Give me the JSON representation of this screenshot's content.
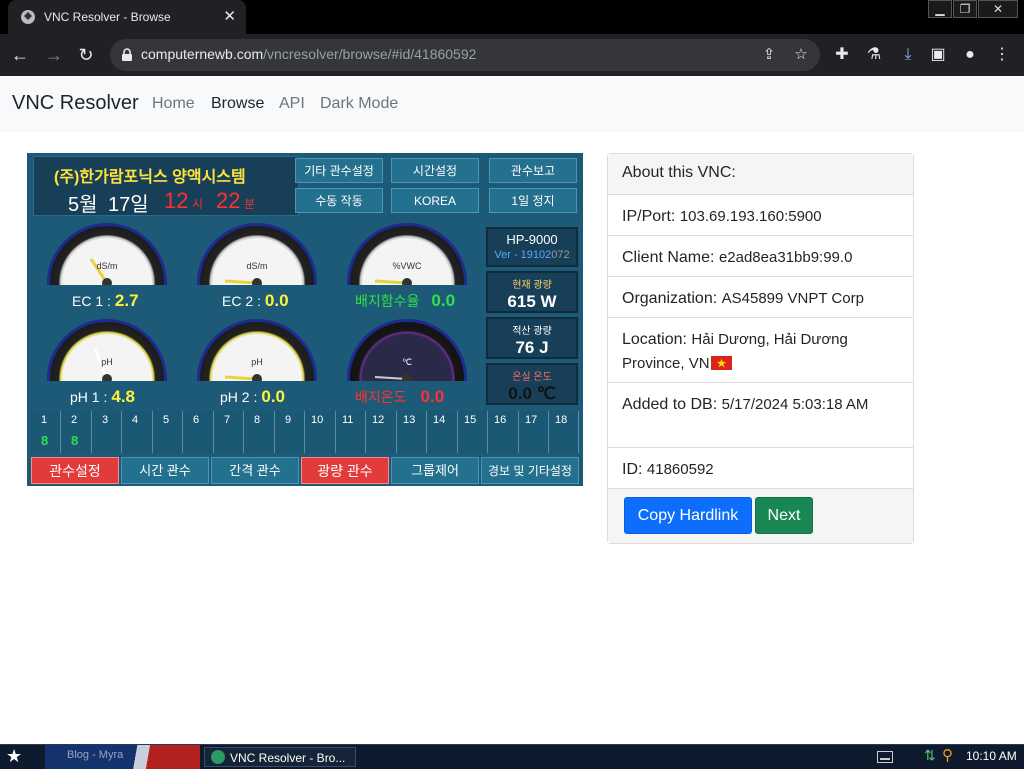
{
  "browser": {
    "tab_title": "VNC Resolver - Browse",
    "url_host": "computernewb.com",
    "url_path": "/vncresolver/browse/#id/41860592"
  },
  "navbar": {
    "brand": "VNC Resolver",
    "links": [
      "Home",
      "Browse",
      "API",
      "Dark Mode"
    ],
    "active": "Browse"
  },
  "vnc_screen": {
    "company": "(주)한가람포닉스 양액시스템",
    "month": "5월",
    "day": "17일",
    "hour": "12",
    "hour_unit": "시",
    "minute": "22",
    "minute_unit": "분",
    "top_buttons": [
      "기타 관수설정",
      "시간설정",
      "관수보고",
      "수동 작동",
      "KOREA",
      "1일 정지"
    ],
    "gauges": [
      {
        "unit": "dS/m",
        "label": "EC 1 :",
        "value": "2.7"
      },
      {
        "unit": "dS/m",
        "label": "EC 2 :",
        "value": "0.0"
      },
      {
        "unit": "%VWC",
        "label": "배지함수율",
        "value": "0.0"
      },
      {
        "unit": "pH",
        "label": "pH 1 :",
        "value": "4.8"
      },
      {
        "unit": "pH",
        "label": "pH 2 :",
        "value": "0.0"
      },
      {
        "unit": "℃",
        "label": "배지온도",
        "value": "0.0"
      }
    ],
    "model": "HP-9000",
    "version": "Ver - 19102",
    "version_suffix": "072",
    "light_now_label": "현재 광량",
    "light_now_value": "615 W",
    "light_sum_label": "적산 광량",
    "light_sum_value": "76 J",
    "temp_label": "온실 온도",
    "temp_value": "0.0 ℃",
    "channels": [
      "1",
      "2",
      "3",
      "4",
      "5",
      "6",
      "7",
      "8",
      "9",
      "10",
      "11",
      "12",
      "13",
      "14",
      "15",
      "16",
      "17",
      "18"
    ],
    "channel_status": {
      "1": "8",
      "2": "8"
    },
    "bottom_menu": [
      "관수설정",
      "시간 관수",
      "간격 관수",
      "광량 관수",
      "그룹제어",
      "경보 및 기타설정"
    ]
  },
  "card": {
    "header": "About this VNC:",
    "rows": [
      {
        "label": "IP/Port:",
        "value": "103.69.193.160:5900"
      },
      {
        "label": "Client Name:",
        "value": "e2ad8ea31bb9:99.0"
      },
      {
        "label": "Organization:",
        "value": "AS45899 VNPT Corp"
      },
      {
        "label": "Location:",
        "value": "Hải Dương, Hải Dương Province, VN"
      },
      {
        "label": "Added to DB:",
        "value": "5/17/2024 5:03:18 AM"
      },
      {
        "label": "ID:",
        "value": "41860592"
      }
    ],
    "copy_label": "Copy Hardlink",
    "next_label": "Next"
  },
  "taskbar": {
    "item1": "Blog - Myra",
    "item2": "VNC Resolver - Bro...",
    "clock": "10:10 AM"
  },
  "colors": {
    "primary": "#0d6efd",
    "success": "#198754",
    "hmi_bg": "#1d5a77",
    "hmi_red": "#e23b3b"
  }
}
